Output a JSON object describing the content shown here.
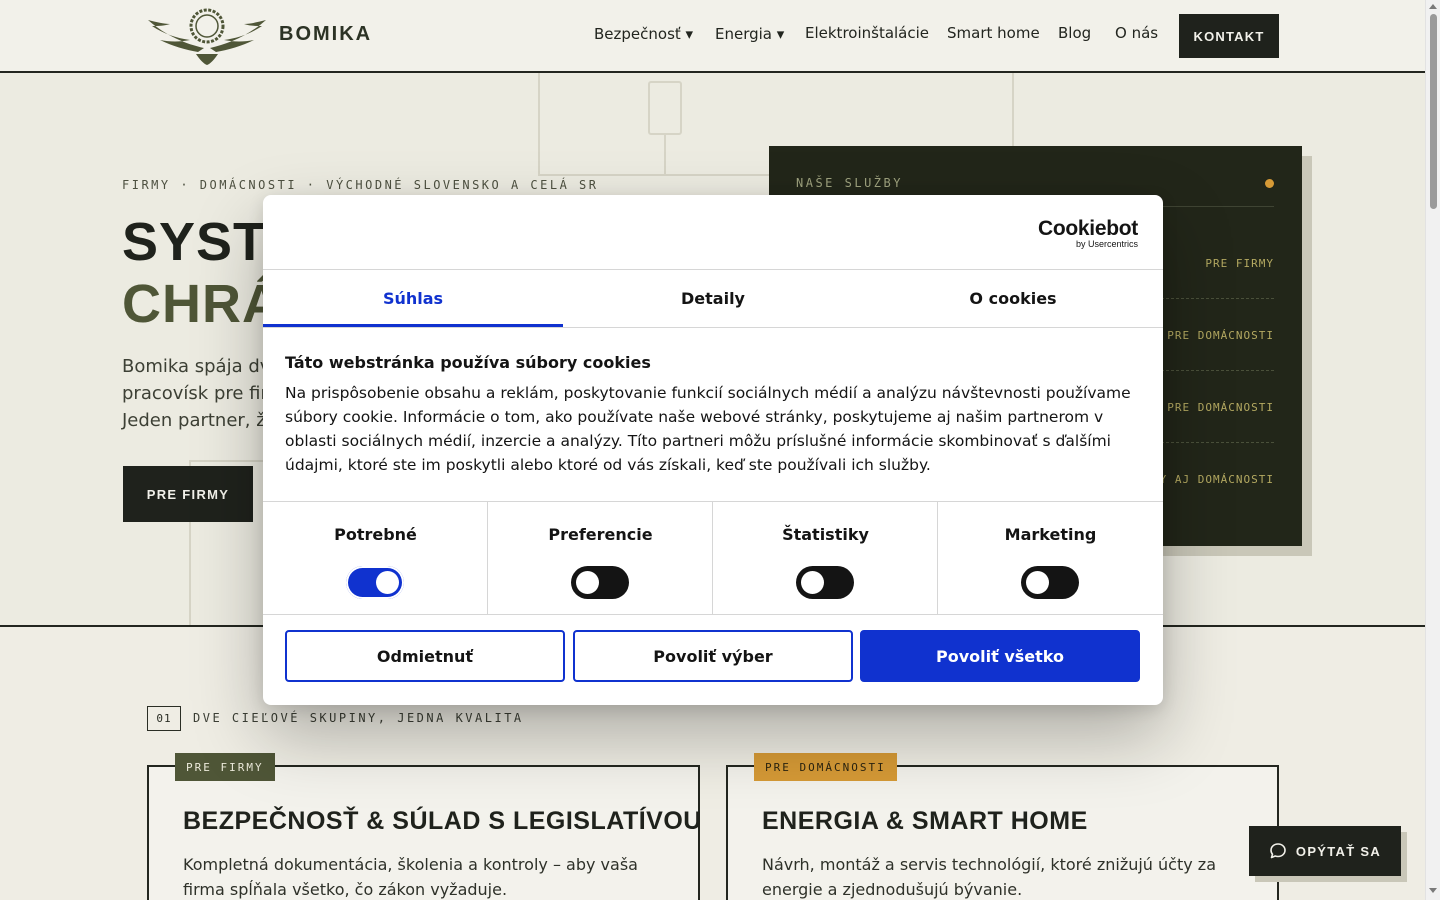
{
  "header": {
    "brand": "BOMIKA",
    "nav": [
      {
        "label": "Bezpečnosť ▾"
      },
      {
        "label": "Energia ▾"
      },
      {
        "label": "Elektroinštalácie"
      },
      {
        "label": "Smart home"
      },
      {
        "label": "Blog"
      },
      {
        "label": "O nás"
      }
    ],
    "cta": "KONTAKT"
  },
  "hero": {
    "eyebrow": "FIRMY · DOMÁCNOSTI · VÝCHODNÉ SLOVENSKO A CELÁ SR",
    "title_line1": "SYSTÉ",
    "title_line2": "CHRÁI",
    "lead_line1": "Bomika spája dve",
    "lead_line2": "pracovísk pre firm",
    "lead_line3": "Jeden partner, žia",
    "button": "PRE FIRMY"
  },
  "services_panel": {
    "title": "NAŠE SLUŽBY",
    "tags": [
      "PRE FIRMY",
      "PRE DOMÁCNOSTI",
      "PRE DOMÁCNOSTI",
      "RMY AJ DOMÁCNOSTI"
    ],
    "accent": "#d69a36"
  },
  "section": {
    "number": "01",
    "label": "DVE CIEĽOVÉ SKUPINY, JEDNA KVALITA",
    "cards": [
      {
        "badge": "PRE FIRMY",
        "badge_color": "#4f5637",
        "title": "BEZPEČNOSŤ & SÚLAD S LEGISLATÍVOU",
        "text": "Kompletná dokumentácia, školenia a kontroly – aby vaša firma spĺňala všetko, čo zákon vyžaduje."
      },
      {
        "badge": "PRE DOMÁCNOSTI",
        "badge_color": "#d69a36",
        "title": "ENERGIA & SMART HOME",
        "text": "Návrh, montáž a servis technológií, ktoré znižujú účty za energie a zjednodušujú bývanie."
      }
    ]
  },
  "chat_button": {
    "label": "OPÝTAŤ SA",
    "icon": "chat-bubble-icon"
  },
  "cookie_dialog": {
    "logo_name": "Cookiebot",
    "logo_sub": "by Usercentrics",
    "tabs": [
      "Súhlas",
      "Detaily",
      "O cookies"
    ],
    "active_tab": "Súhlas",
    "heading": "Táto webstránka používa súbory cookies",
    "body": "Na prispôsobenie obsahu a reklám, poskytovanie funkcií sociálnych médií a analýzu návštevnosti používame súbory cookie. Informácie o tom, ako používate naše webové stránky, poskytujeme aj našim partnerom v oblasti sociálnych médií, inzercie a analýzy. Títo partneri môžu príslušné informácie skombinovať s ďalšími údajmi, ktoré ste im poskytli alebo ktoré od vás získali, keď ste používali ich služby.",
    "categories": [
      {
        "label": "Potrebné",
        "enabled": true
      },
      {
        "label": "Preferencie",
        "enabled": false
      },
      {
        "label": "Štatistiky",
        "enabled": false
      },
      {
        "label": "Marketing",
        "enabled": false
      }
    ],
    "buttons": {
      "deny": "Odmietnuť",
      "allow_selection": "Povoliť výber",
      "allow_all": "Povoliť všetko"
    },
    "accent": "#1032cf"
  }
}
